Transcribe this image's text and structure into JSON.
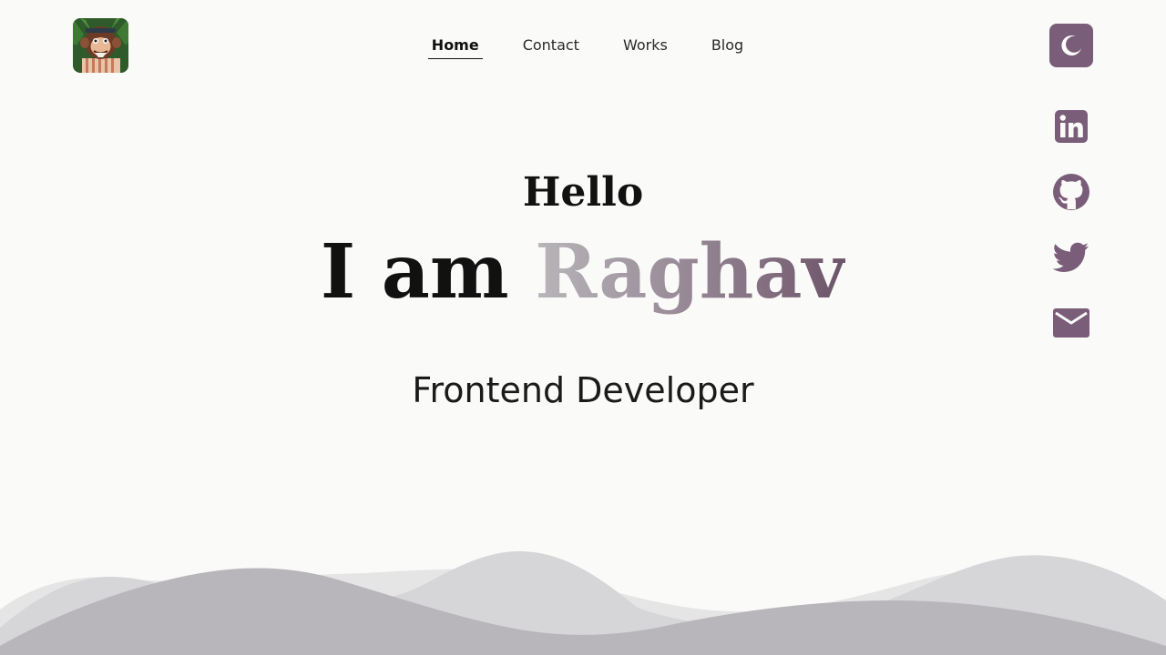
{
  "header": {
    "logo_alt": "monkey avatar",
    "nav": [
      {
        "label": "Home",
        "active": true
      },
      {
        "label": "Contact",
        "active": false
      },
      {
        "label": "Works",
        "active": false
      },
      {
        "label": "Blog",
        "active": false
      }
    ],
    "theme_toggle_icon": "moon-icon"
  },
  "socials": [
    {
      "icon": "linkedin-icon"
    },
    {
      "icon": "github-icon"
    },
    {
      "icon": "twitter-icon"
    },
    {
      "icon": "mail-icon"
    }
  ],
  "hero": {
    "greeting": "Hello",
    "intro": "I am",
    "name": "Raghav",
    "role": "Frontend Developer"
  },
  "colors": {
    "accent": "#7a5d78",
    "background": "#fafaf8",
    "text": "#111111",
    "wave_dark": "#b8b6ba",
    "wave_light": "#dcdbdc"
  }
}
